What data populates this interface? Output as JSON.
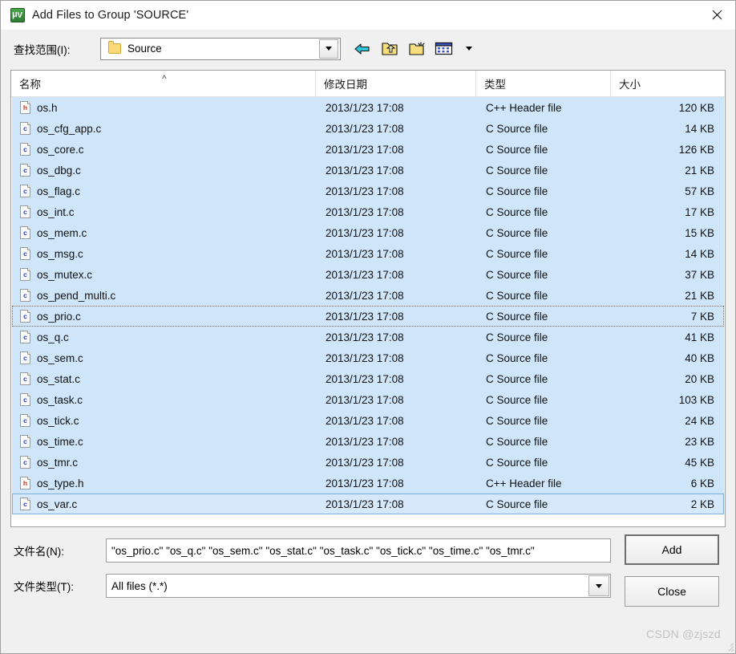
{
  "window": {
    "title": "Add Files to Group 'SOURCE'",
    "app_icon": "uvision-icon",
    "close_label": "×"
  },
  "lookin": {
    "label": "查找范围(I):",
    "value": "Source",
    "folder_icon": "folder-icon",
    "dropdown_icon": "chevron-down-icon"
  },
  "toolbar": {
    "back_icon": "back-arrow-icon",
    "up_icon": "up-one-level-icon",
    "new_folder_icon": "new-folder-icon",
    "view_icon": "views-icon",
    "view_dropdown_icon": "chevron-down-icon"
  },
  "list": {
    "columns": [
      {
        "key": "name",
        "label": "名称",
        "sort": "asc"
      },
      {
        "key": "date",
        "label": "修改日期"
      },
      {
        "key": "type",
        "label": "类型"
      },
      {
        "key": "size",
        "label": "大小"
      }
    ],
    "rows": [
      {
        "icon": "h",
        "name": "os.h",
        "date": "2013/1/23 17:08",
        "type": "C++ Header file",
        "size": "120 KB",
        "state": "selected"
      },
      {
        "icon": "c",
        "name": "os_cfg_app.c",
        "date": "2013/1/23 17:08",
        "type": "C Source file",
        "size": "14 KB",
        "state": "selected"
      },
      {
        "icon": "c",
        "name": "os_core.c",
        "date": "2013/1/23 17:08",
        "type": "C Source file",
        "size": "126 KB",
        "state": "selected"
      },
      {
        "icon": "c",
        "name": "os_dbg.c",
        "date": "2013/1/23 17:08",
        "type": "C Source file",
        "size": "21 KB",
        "state": "selected"
      },
      {
        "icon": "c",
        "name": "os_flag.c",
        "date": "2013/1/23 17:08",
        "type": "C Source file",
        "size": "57 KB",
        "state": "selected"
      },
      {
        "icon": "c",
        "name": "os_int.c",
        "date": "2013/1/23 17:08",
        "type": "C Source file",
        "size": "17 KB",
        "state": "selected"
      },
      {
        "icon": "c",
        "name": "os_mem.c",
        "date": "2013/1/23 17:08",
        "type": "C Source file",
        "size": "15 KB",
        "state": "selected"
      },
      {
        "icon": "c",
        "name": "os_msg.c",
        "date": "2013/1/23 17:08",
        "type": "C Source file",
        "size": "14 KB",
        "state": "selected"
      },
      {
        "icon": "c",
        "name": "os_mutex.c",
        "date": "2013/1/23 17:08",
        "type": "C Source file",
        "size": "37 KB",
        "state": "selected"
      },
      {
        "icon": "c",
        "name": "os_pend_multi.c",
        "date": "2013/1/23 17:08",
        "type": "C Source file",
        "size": "21 KB",
        "state": "selected"
      },
      {
        "icon": "c",
        "name": "os_prio.c",
        "date": "2013/1/23 17:08",
        "type": "C Source file",
        "size": "7 KB",
        "state": "focused"
      },
      {
        "icon": "c",
        "name": "os_q.c",
        "date": "2013/1/23 17:08",
        "type": "C Source file",
        "size": "41 KB",
        "state": "selected"
      },
      {
        "icon": "c",
        "name": "os_sem.c",
        "date": "2013/1/23 17:08",
        "type": "C Source file",
        "size": "40 KB",
        "state": "selected"
      },
      {
        "icon": "c",
        "name": "os_stat.c",
        "date": "2013/1/23 17:08",
        "type": "C Source file",
        "size": "20 KB",
        "state": "selected"
      },
      {
        "icon": "c",
        "name": "os_task.c",
        "date": "2013/1/23 17:08",
        "type": "C Source file",
        "size": "103 KB",
        "state": "selected"
      },
      {
        "icon": "c",
        "name": "os_tick.c",
        "date": "2013/1/23 17:08",
        "type": "C Source file",
        "size": "24 KB",
        "state": "selected"
      },
      {
        "icon": "c",
        "name": "os_time.c",
        "date": "2013/1/23 17:08",
        "type": "C Source file",
        "size": "23 KB",
        "state": "selected"
      },
      {
        "icon": "c",
        "name": "os_tmr.c",
        "date": "2013/1/23 17:08",
        "type": "C Source file",
        "size": "45 KB",
        "state": "selected"
      },
      {
        "icon": "h",
        "name": "os_type.h",
        "date": "2013/1/23 17:08",
        "type": "C++ Header file",
        "size": "6 KB",
        "state": "selected"
      },
      {
        "icon": "c",
        "name": "os_var.c",
        "date": "2013/1/23 17:08",
        "type": "C Source file",
        "size": "2 KB",
        "state": "last-selected"
      }
    ]
  },
  "form": {
    "filename_label": "文件名(N):",
    "filename_value": "\"os_prio.c\" \"os_q.c\" \"os_sem.c\" \"os_stat.c\" \"os_task.c\" \"os_tick.c\" \"os_time.c\" \"os_tmr.c\"",
    "filetype_label": "文件类型(T):",
    "filetype_value": "All files (*.*)"
  },
  "buttons": {
    "add": "Add",
    "close": "Close"
  },
  "watermark": "CSDN @zjszd",
  "colors": {
    "selection": "#cfe6fa",
    "dialog_bg": "#f0f0f0",
    "header_icon_red": "#c0392b",
    "source_icon_blue": "#2b41c0"
  }
}
